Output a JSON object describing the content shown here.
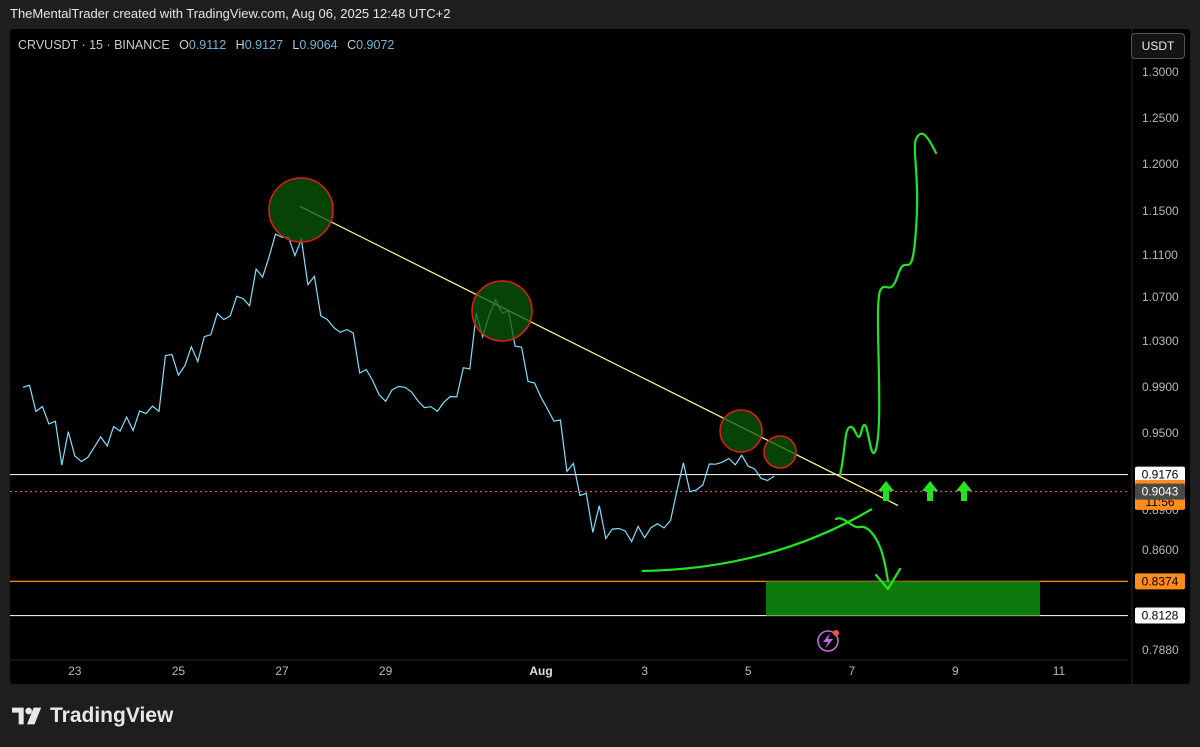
{
  "header": {
    "attribution": "TheMentalTrader created with TradingView.com, Aug 06, 2025 12:48 UTC+2"
  },
  "legend": {
    "symbol_line": "CRVUSDT · 15 · BINANCE",
    "o_label": "O",
    "o_value": "0.9112",
    "h_label": "H",
    "h_value": "0.9127",
    "l_label": "L",
    "l_value": "0.9064",
    "c_label": "C",
    "c_value": "0.9072"
  },
  "currency_button": "USDT",
  "footer": {
    "brand": "TradingView"
  },
  "colors": {
    "background": "#000000",
    "price_line": "#7fe0ff",
    "trendline": "#f5ef8a",
    "circles": "#e31b1b",
    "arrows": "#22e422",
    "zone": "#0c7a0c",
    "orange_level": "#ff8c1a",
    "current_price": "#ff8c1a"
  },
  "chart_data": {
    "type": "line",
    "title": "",
    "x_ticks": [
      "23",
      "25",
      "27",
      "29",
      "Aug",
      "3",
      "5",
      "7",
      "9",
      "11"
    ],
    "y_ticks": [
      "1.3000",
      "1.2500",
      "1.2000",
      "1.1500",
      "1.1100",
      "1.0700",
      "1.0300",
      "0.9900",
      "0.9500",
      "0.8900",
      "0.8600",
      "0.7880"
    ],
    "price_labels": [
      {
        "value": "0.9176",
        "style": "white"
      },
      {
        "value": "0.9072",
        "style": "orange",
        "extra": "11:56"
      },
      {
        "value": "0.9043",
        "style": "gray"
      },
      {
        "value": "0.8374",
        "style": "orange"
      },
      {
        "value": "0.8128",
        "style": "white"
      }
    ],
    "series": [
      {
        "x": [
          "Jul 22",
          "Jul 23",
          "Jul 24",
          "Jul 25",
          "Jul 26",
          "Jul 27",
          "Jul 28",
          "Jul 29",
          "Jul 30",
          "Jul 31",
          "Aug 1",
          "Aug 2",
          "Aug 3",
          "Aug 4",
          "Aug 5",
          "Aug 6"
        ],
        "values": [
          0.99,
          0.93,
          0.96,
          1.01,
          1.06,
          1.13,
          1.04,
          0.99,
          0.97,
          1.06,
          0.98,
          0.88,
          0.87,
          0.92,
          0.93,
          0.9
        ]
      }
    ],
    "levels": [
      0.9176,
      0.9043,
      0.8374,
      0.8128
    ],
    "current_price": 0.9072,
    "countdown": "11:56",
    "ylim": [
      0.788,
      1.32
    ]
  }
}
